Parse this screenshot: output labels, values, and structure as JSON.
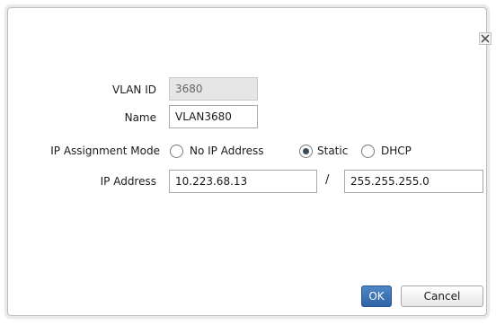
{
  "dialog": {
    "close_icon": "close-icon",
    "fields": {
      "vlan_id_label": "VLAN ID",
      "vlan_id_value": "3680",
      "name_label": "Name",
      "name_value": "VLAN3680",
      "ip_mode_label": "IP Assignment Mode",
      "ip_mode_options": [
        "No IP Address",
        "Static",
        "DHCP"
      ],
      "ip_mode_selected": "Static",
      "ip_address_label": "IP Address",
      "ip_address_value": "10.223.68.13",
      "separator": "/",
      "subnet_mask_value": "255.255.255.0"
    },
    "buttons": {
      "ok_label": "OK",
      "cancel_label": "Cancel"
    },
    "colors": {
      "ok_button": "#2f63a6",
      "readonly_field": "#e6e6e6"
    }
  }
}
